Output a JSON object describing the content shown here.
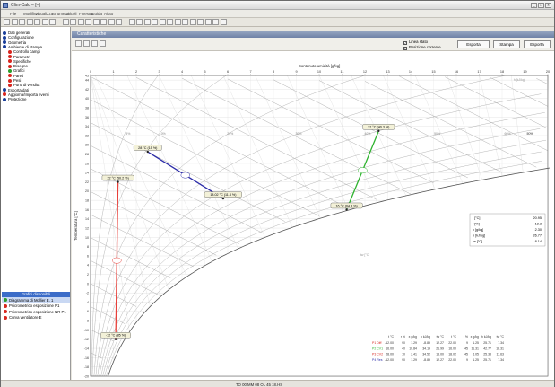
{
  "window": {
    "title": "Clim-Calc – [–]"
  },
  "menu": [
    "File",
    "Modifica",
    "Visualizza",
    "Strumenti",
    "Calcoli",
    "Finestra",
    "Guida",
    "Aiuto"
  ],
  "sidebar": {
    "tree": [
      {
        "label": "Dati generali",
        "level": 0,
        "color": "#1a3f9a"
      },
      {
        "label": "Configurazione",
        "level": 0,
        "color": "#1a3f9a"
      },
      {
        "label": "Geometria",
        "level": 0,
        "color": "#1a3f9a"
      },
      {
        "label": "Ambiente di stampa",
        "level": 0,
        "color": "#1a3f9a"
      },
      {
        "label": "Controllo campi",
        "level": 1,
        "color": "#d8261f"
      },
      {
        "label": "Parametri",
        "level": 1,
        "color": "#d8261f"
      },
      {
        "label": "Specifiche",
        "level": 1,
        "color": "#d8261f"
      },
      {
        "label": "Disegno",
        "level": 1,
        "color": "#d8261f"
      },
      {
        "label": "Grafici",
        "level": 1,
        "color": "#2a9e2a"
      },
      {
        "label": "Pareti",
        "level": 1,
        "color": "#d8261f"
      },
      {
        "label": "Pesi",
        "level": 1,
        "color": "#d8261f"
      },
      {
        "label": "Punti di vendita",
        "level": 1,
        "color": "#d8261f"
      },
      {
        "label": "Esporta dati",
        "level": 0,
        "color": "#1a3f9a"
      },
      {
        "label": "Aggiorna/Importa eventi",
        "level": 0,
        "color": "#d8261f"
      },
      {
        "label": "Protezione",
        "level": 0,
        "color": "#1a3f9a"
      }
    ],
    "section_title": "Grafici disponibili",
    "section_items": [
      {
        "label": "Diagramma di Mollier E. 1",
        "color": "#2a9e2a",
        "selected": true
      },
      {
        "label": "Psicrometrico esposizione P1",
        "color": "#d8261f",
        "selected": false
      },
      {
        "label": "Psicrometrico esposizione NR P1",
        "color": "#d8261f",
        "selected": false
      },
      {
        "label": "Curva ventilatore E",
        "color": "#d8261f",
        "selected": false
      }
    ]
  },
  "panel": {
    "title": "Caratteristiche",
    "check_labels": [
      "Linea stato",
      "Posizione corrente"
    ],
    "buttons": [
      "Esporta",
      "Stampa",
      "Esporta"
    ]
  },
  "status": {
    "center": "TO 00.MM 08 OL 45 18.HS"
  },
  "chart_data": {
    "type": "psychrometric",
    "x_axis": {
      "title": "Contenuto umidità [g/kg]",
      "min": 0,
      "max": 20,
      "ticks": [
        0,
        1,
        2,
        3,
        4,
        5,
        6,
        7,
        8,
        9,
        10,
        11,
        12,
        13,
        14,
        15,
        16,
        17,
        18,
        19,
        20
      ]
    },
    "y_axis": {
      "title": "Temperatura [°C]",
      "min": -20,
      "max": 45,
      "ticks": [
        45,
        44,
        42,
        40,
        38,
        36,
        34,
        32,
        30,
        28,
        26,
        24,
        22,
        20,
        18,
        16,
        14,
        12,
        10,
        8,
        6,
        4,
        2,
        0,
        -2,
        -4,
        -6,
        -8,
        -10,
        -12,
        -14,
        -16,
        -18,
        -20
      ]
    },
    "rh_labels": [
      "90%",
      "80%",
      "70%",
      "60%",
      "50%",
      "40%",
      "30%",
      "20%",
      "10%",
      "5%"
    ],
    "enthalpy_label": "h [kJ/kg]",
    "points": [
      {
        "id": "P1",
        "label": "22 °C (50.2 %)",
        "x": 1.2,
        "y": 22
      },
      {
        "id": "P2",
        "label": "28 °C (15 %)",
        "x": 2.5,
        "y": 28.5
      },
      {
        "id": "P3",
        "label": "18.02 °C (11.3 %)",
        "x": 5.8,
        "y": 18.4
      },
      {
        "id": "P4",
        "label": "-12 °C (85 %)",
        "x": 1.1,
        "y": -12
      },
      {
        "id": "P5",
        "label": "32 °C (40.3 %)",
        "x": 12.6,
        "y": 33
      },
      {
        "id": "P6",
        "label": "16 °C (64.8 %)",
        "x": 11.2,
        "y": 16
      }
    ],
    "lines": [
      {
        "from": "P2",
        "to": "P3",
        "color": "#2c2ca8"
      },
      {
        "from": "P1",
        "to": "P4",
        "color": "#e8403a"
      },
      {
        "from": "P5",
        "to": "P6",
        "color": "#2fb32f"
      }
    ],
    "info_box": [
      {
        "label": "t [°C]",
        "value": "20.95"
      },
      {
        "label": "r [%]",
        "value": "12.3"
      },
      {
        "label": "x [g/kg]",
        "value": "2.30"
      },
      {
        "label": "h [kJ/kg]",
        "value": "26.77"
      },
      {
        "label": "tw [°C]",
        "value": "8.14"
      }
    ],
    "table": {
      "headers": [
        "t °C",
        "r %",
        "x g/kg",
        "h kJ/kg",
        "tw °C",
        "t °C",
        "r %",
        "x g/kg",
        "h kJ/kg",
        "tw °C"
      ],
      "rows": [
        {
          "id": "P1",
          "name": "Diff",
          "color": "#d8261f",
          "values": [
            "-12.00",
            "90",
            "1.29",
            "-8.89",
            "12.27",
            "22.00",
            "9",
            "1.25",
            "25.71",
            "7.34"
          ]
        },
        {
          "id": "P2",
          "name": "CV1",
          "color": "#2fb32f",
          "values": [
            "16.00",
            "40",
            "10.84",
            "34.19",
            "21.99",
            "16.00",
            "45",
            "11.31",
            "42.77",
            "18.31"
          ]
        },
        {
          "id": "P3",
          "name": "CV2",
          "color": "#d8261f",
          "values": [
            "28.00",
            "10",
            "2.41",
            "34.52",
            "15.00",
            "18.02",
            "45",
            "6.05",
            "25.38",
            "11.63"
          ]
        },
        {
          "id": "P4",
          "name": "Res",
          "color": "#2c2ca8",
          "values": [
            "-12.00",
            "90",
            "1.29",
            "-8.89",
            "12.27",
            "22.00",
            "9",
            "1.25",
            "25.71",
            "7.34"
          ]
        }
      ]
    }
  }
}
